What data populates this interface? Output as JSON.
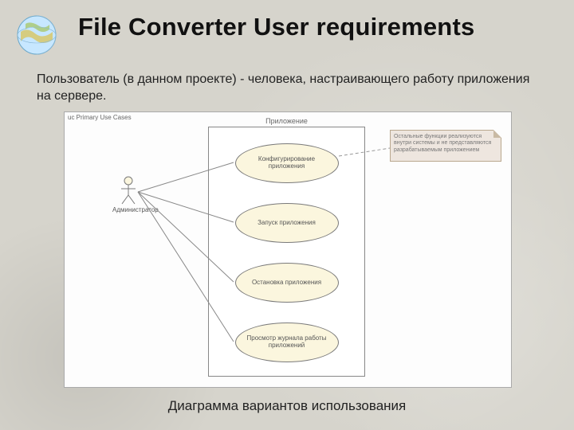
{
  "title": "File Converter User requirements",
  "subtitle": "Пользователь (в данном проекте) - человека, настраивающего работу приложения на сервере.",
  "caption": "Диаграмма вариантов использования",
  "diagram": {
    "header": "uc Primary Use Cases",
    "system_label": "Приложение",
    "actor": "Администратор",
    "usecases": [
      "Конфигурирование приложения",
      "Запуск приложения",
      "Остановка приложения",
      "Просмотр журнала работы приложений"
    ],
    "note": "Остальные функции реализуются внутри системы и не представляются разрабатываемым приложением"
  }
}
